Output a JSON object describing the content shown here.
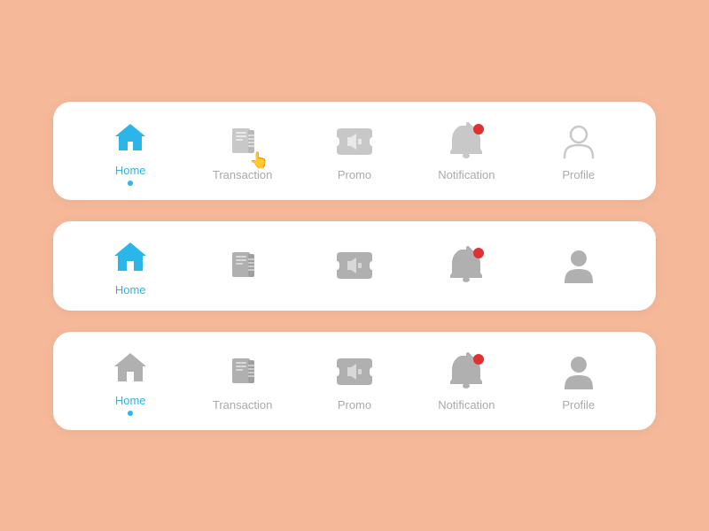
{
  "bars": [
    {
      "id": "bar1",
      "variant": "outlined-active",
      "items": [
        {
          "id": "home",
          "label": "Home",
          "active": true,
          "dot": true,
          "cursor": false
        },
        {
          "id": "transaction",
          "label": "Transaction",
          "active": false,
          "dot": false,
          "cursor": true
        },
        {
          "id": "promo",
          "label": "Promo",
          "active": false,
          "dot": false,
          "cursor": false
        },
        {
          "id": "notification",
          "label": "Notification",
          "active": false,
          "dot": false,
          "cursor": false,
          "badge": true
        },
        {
          "id": "profile",
          "label": "Profile",
          "active": false,
          "dot": false,
          "cursor": false
        }
      ]
    },
    {
      "id": "bar2",
      "variant": "filled-active",
      "items": [
        {
          "id": "home",
          "label": "Home",
          "active": true,
          "dot": false,
          "cursor": false
        },
        {
          "id": "transaction",
          "label": "",
          "active": false,
          "dot": false,
          "cursor": false
        },
        {
          "id": "promo",
          "label": "",
          "active": false,
          "dot": false,
          "cursor": false
        },
        {
          "id": "notification",
          "label": "",
          "active": false,
          "dot": false,
          "cursor": false,
          "badge": true
        },
        {
          "id": "profile",
          "label": "",
          "active": false,
          "dot": false,
          "cursor": false
        }
      ]
    },
    {
      "id": "bar3",
      "variant": "text-active",
      "items": [
        {
          "id": "home",
          "label": "Home",
          "active": true,
          "dot": true,
          "cursor": false
        },
        {
          "id": "transaction",
          "label": "Transaction",
          "active": false,
          "dot": false,
          "cursor": false
        },
        {
          "id": "promo",
          "label": "Promo",
          "active": false,
          "dot": false,
          "cursor": false
        },
        {
          "id": "notification",
          "label": "Notification",
          "active": false,
          "dot": false,
          "cursor": false,
          "badge": true
        },
        {
          "id": "profile",
          "label": "Profile",
          "active": false,
          "dot": false,
          "cursor": false
        }
      ]
    }
  ],
  "colors": {
    "active_blue": "#2BB5E8",
    "inactive_gray": "#C0C0C0",
    "badge_red": "#E03030",
    "bg_peach": "#F5B99A"
  }
}
